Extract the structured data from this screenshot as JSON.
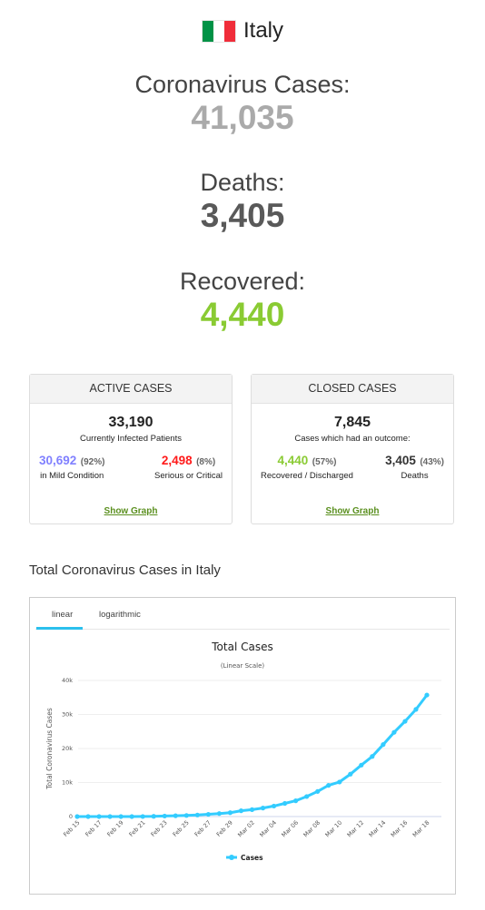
{
  "country": {
    "name": "Italy",
    "flag_icon": "italy-flag-icon",
    "flag_colors": [
      "#009246",
      "#ffffff",
      "#f02d3a"
    ]
  },
  "counters": [
    {
      "label": "Coronavirus Cases:",
      "value": "41,035",
      "color": "#aaaaaa"
    },
    {
      "label": "Deaths:",
      "value": "3,405",
      "color": "#595959"
    },
    {
      "label": "Recovered:",
      "value": "4,440",
      "color": "#8acb33"
    }
  ],
  "active_cases": {
    "title": "ACTIVE CASES",
    "total": "33,190",
    "subtitle": "Currently Infected Patients",
    "left": {
      "value": "30,692",
      "percent": "(92%)",
      "label": "in Mild Condition",
      "color": "#8080ff"
    },
    "right": {
      "value": "2,498",
      "percent": "(8%)",
      "label": "Serious or Critical",
      "color": "#ff1a1a"
    },
    "link": "Show Graph"
  },
  "closed_cases": {
    "title": "CLOSED CASES",
    "total": "7,845",
    "subtitle": "Cases which had an outcome:",
    "left": {
      "value": "4,440",
      "percent": "(57%)",
      "label": "Recovered / Discharged",
      "color": "#8acb33"
    },
    "right": {
      "value": "3,405",
      "percent": "(43%)",
      "label": "Deaths",
      "color": "#333333"
    },
    "link": "Show Graph"
  },
  "graph_section": {
    "title": "Total Coronavirus Cases in Italy",
    "tabs": [
      {
        "label": "linear",
        "active": true
      },
      {
        "label": "logarithmic",
        "active": false
      }
    ]
  },
  "chart_data": {
    "type": "line",
    "title": "Total Cases",
    "subtitle": "(Linear Scale)",
    "xlabel": "",
    "ylabel": "Total Coronavirus Cases",
    "ylim": [
      0,
      40000
    ],
    "yticks": [
      0,
      10000,
      20000,
      30000,
      40000
    ],
    "ytick_labels": [
      "0",
      "10k",
      "20k",
      "30k",
      "40k"
    ],
    "grid": true,
    "legend": "bottom-center",
    "line_color": "#33ccff",
    "x": [
      "Feb 15",
      "Feb 16",
      "Feb 17",
      "Feb 18",
      "Feb 19",
      "Feb 20",
      "Feb 21",
      "Feb 22",
      "Feb 23",
      "Feb 24",
      "Feb 25",
      "Feb 26",
      "Feb 27",
      "Feb 28",
      "Feb 29",
      "Mar 01",
      "Mar 02",
      "Mar 03",
      "Mar 04",
      "Mar 05",
      "Mar 06",
      "Mar 07",
      "Mar 08",
      "Mar 09",
      "Mar 10",
      "Mar 11",
      "Mar 12",
      "Mar 13",
      "Mar 14",
      "Mar 15",
      "Mar 16",
      "Mar 17",
      "Mar 18"
    ],
    "xtick_labels": [
      "Feb 15",
      "Feb 17",
      "Feb 19",
      "Feb 21",
      "Feb 23",
      "Feb 25",
      "Feb 27",
      "Feb 29",
      "Mar 02",
      "Mar 04",
      "Mar 06",
      "Mar 08",
      "Mar 10",
      "Mar 12",
      "Mar 14",
      "Mar 16",
      "Mar 18"
    ],
    "series": [
      {
        "name": "Cases",
        "values": [
          3,
          3,
          3,
          3,
          3,
          3,
          20,
          62,
          155,
          229,
          322,
          453,
          655,
          888,
          1128,
          1694,
          2036,
          2502,
          3089,
          3858,
          4636,
          5883,
          7375,
          9172,
          10149,
          12462,
          15113,
          17660,
          21157,
          24747,
          27980,
          31506,
          35713
        ]
      }
    ]
  }
}
